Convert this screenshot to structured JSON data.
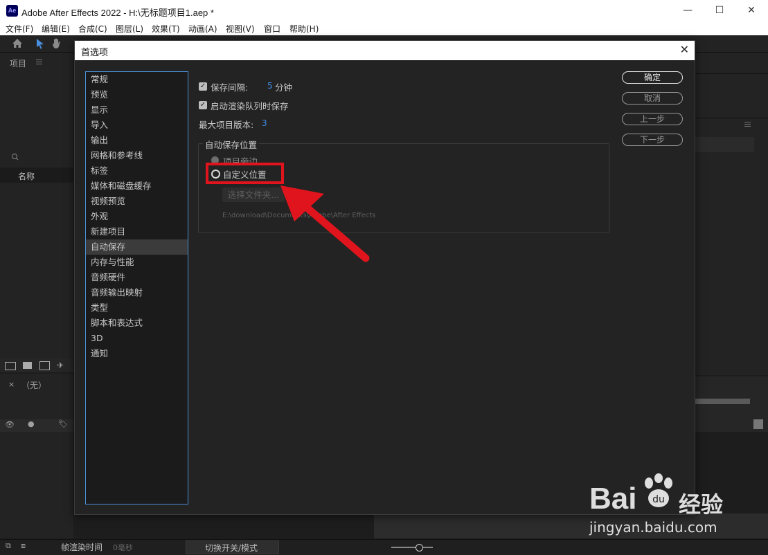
{
  "window": {
    "title": "Adobe After Effects 2022 - H:\\无标题项目1.aep *",
    "app_icon": "Ae",
    "min_glyph": "—",
    "max_glyph": "☐",
    "close_glyph": "✕"
  },
  "menu": [
    "文件(F)",
    "编辑(E)",
    "合成(C)",
    "图层(L)",
    "效果(T)",
    "动画(A)",
    "视图(V)",
    "窗口",
    "帮助(H)"
  ],
  "background": {
    "project_tab": "项目",
    "name_column": "名称",
    "none_label": "（无）",
    "render_time_label": "帧渲染时间",
    "render_time_value": "0毫秒",
    "toggle_mode_label": "切换开关/模式"
  },
  "dialog": {
    "title": "首选项",
    "categories": [
      "常规",
      "预览",
      "显示",
      "导入",
      "输出",
      "网格和参考线",
      "标签",
      "媒体和磁盘缓存",
      "视频预览",
      "外观",
      "新建项目",
      "自动保存",
      "内存与性能",
      "音频硬件",
      "音频输出映射",
      "类型",
      "脚本和表达式",
      "3D",
      "通知"
    ],
    "selected_index": 11,
    "save_interval_label": "保存间隔:",
    "save_interval_value": "5",
    "save_interval_unit": "分钟",
    "save_on_render_label": "启动渲染队列时保存",
    "max_versions_label": "最大项目版本:",
    "max_versions_value": "3",
    "location_group_title": "自动保存位置",
    "option_next_to_project": "项目旁边",
    "option_custom": "自定义位置",
    "choose_folder_button": "选择文件夹...",
    "custom_path": "E:\\download\\Documents\\Adobe\\After Effects",
    "ok": "确定",
    "cancel": "取消",
    "previous": "上一步",
    "next": "下一步"
  },
  "watermark": {
    "brand": "Bai",
    "brand_cn": "经验",
    "url": "jingyan.baidu.com"
  },
  "colors": {
    "accent_blue": "#3f8fe8",
    "highlight_red": "#e0141c"
  }
}
